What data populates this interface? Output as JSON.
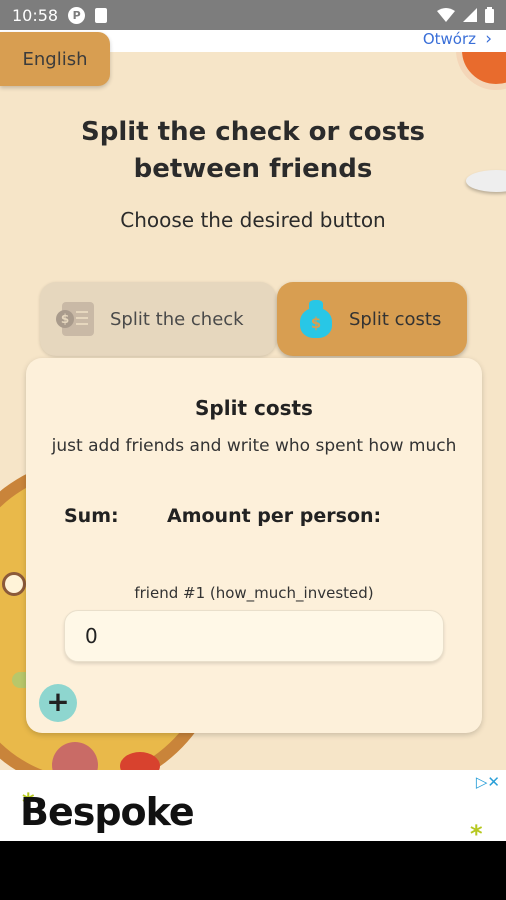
{
  "status_bar": {
    "time": "10:58"
  },
  "top_ad": {
    "open_label": "Otwórz",
    "chevron": "›"
  },
  "language_button": {
    "label": "English"
  },
  "header": {
    "title_line1": "Split the check or costs",
    "title_line2": "between friends",
    "subtitle": "Choose the desired button"
  },
  "tabs": [
    {
      "label": "Split the check",
      "icon": "receipt-dollar-icon",
      "active": false
    },
    {
      "label": "Split costs",
      "icon": "money-bag-icon",
      "active": true
    }
  ],
  "card": {
    "title": "Split costs",
    "description": "just add friends and write who spent how much",
    "sum_label": "Sum:",
    "amount_label": "Amount per person:",
    "friend_label": "friend #1 (how_much_invested)",
    "friend_value": "0",
    "add_button": "+"
  },
  "bottom_ad": {
    "brand": "Bespoke",
    "star": "*",
    "ad_choices": "▷✕"
  },
  "colors": {
    "background": "#f6e5c8",
    "accent": "#d89e51",
    "card": "#fdf0da",
    "add_button": "#8ed6cf"
  }
}
